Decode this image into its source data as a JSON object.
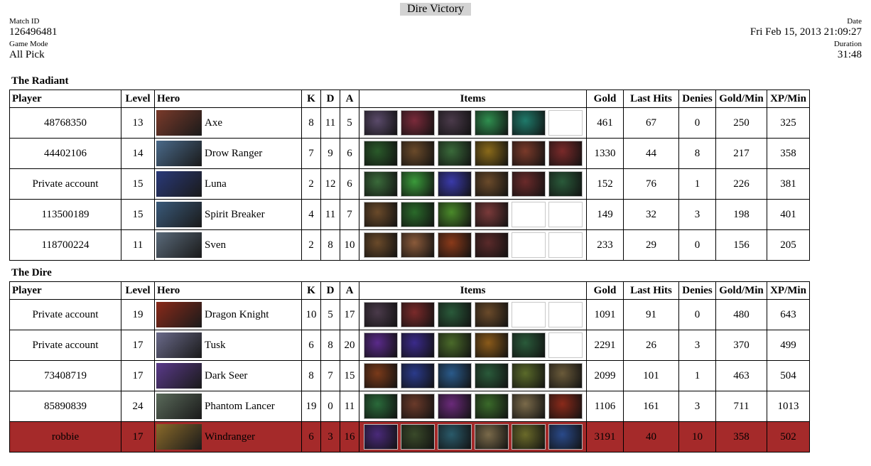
{
  "header": {
    "result": "Dire Victory",
    "match_id_label": "Match ID",
    "match_id": "126496481",
    "game_mode_label": "Game Mode",
    "game_mode": "All Pick",
    "date_label": "Date",
    "date": "Fri Feb 15, 2013 21:09:27",
    "duration_label": "Duration",
    "duration": "31:48"
  },
  "columns": {
    "player": "Player",
    "level": "Level",
    "hero": "Hero",
    "k": "K",
    "d": "D",
    "a": "A",
    "items": "Items",
    "gold": "Gold",
    "last_hits": "Last Hits",
    "denies": "Denies",
    "gpm": "Gold/Min",
    "xpm": "XP/Min"
  },
  "radiant": {
    "title": "The Radiant",
    "players": [
      {
        "player": "48768350",
        "level": "13",
        "hero": "Axe",
        "k": "8",
        "d": "11",
        "a": "5",
        "gold": "461",
        "last_hits": "67",
        "denies": "0",
        "gpm": "250",
        "xpm": "325",
        "hero_color": "#7a3a2a",
        "items": [
          "#5a4a6a",
          "#7a2a3a",
          "#4a3a4a",
          "#2f8f4f",
          "#1f7a6a",
          "",
          ""
        ]
      },
      {
        "player": "44402106",
        "level": "14",
        "hero": "Drow Ranger",
        "k": "7",
        "d": "9",
        "a": "6",
        "gold": "1330",
        "last_hits": "44",
        "denies": "8",
        "gpm": "217",
        "xpm": "358",
        "hero_color": "#4a6a8a",
        "items": [
          "#2a5a2a",
          "#6a4a2a",
          "#3a6a3a",
          "#8a6a1a",
          "#7a3a2a",
          "#7a2a2a",
          ""
        ]
      },
      {
        "player": "Private account",
        "level": "15",
        "hero": "Luna",
        "k": "2",
        "d": "12",
        "a": "6",
        "gold": "152",
        "last_hits": "76",
        "denies": "1",
        "gpm": "226",
        "xpm": "381",
        "hero_color": "#2a3a7a",
        "items": [
          "#3a6a3a",
          "#3a9a3a",
          "#3a3aaa",
          "#6a4a2a",
          "#6a2a2a",
          "#2a5a3a"
        ]
      },
      {
        "player": "113500189",
        "level": "15",
        "hero": "Spirit Breaker",
        "k": "4",
        "d": "11",
        "a": "7",
        "gold": "149",
        "last_hits": "32",
        "denies": "3",
        "gpm": "198",
        "xpm": "401",
        "hero_color": "#3a5a7a",
        "items": [
          "#6a4a2a",
          "#2a6a2a",
          "#4a8a2a",
          "#7a3a3a",
          "",
          ""
        ]
      },
      {
        "player": "118700224",
        "level": "11",
        "hero": "Sven",
        "k": "2",
        "d": "8",
        "a": "10",
        "gold": "233",
        "last_hits": "29",
        "denies": "0",
        "gpm": "156",
        "xpm": "205",
        "hero_color": "#5a6a7a",
        "items": [
          "#6a4a2a",
          "#8a5a3a",
          "#8a3a1a",
          "#5a2a2a",
          "",
          ""
        ]
      }
    ]
  },
  "dire": {
    "title": "The Dire",
    "players": [
      {
        "player": "Private account",
        "level": "19",
        "hero": "Dragon Knight",
        "k": "10",
        "d": "5",
        "a": "17",
        "gold": "1091",
        "last_hits": "91",
        "denies": "0",
        "gpm": "480",
        "xpm": "643",
        "hero_color": "#8a2a1a",
        "items": [
          "#4a3a4a",
          "#7a2a2a",
          "#2a5a3a",
          "#6a4a2a",
          "",
          ""
        ],
        "highlight": false
      },
      {
        "player": "Private account",
        "level": "17",
        "hero": "Tusk",
        "k": "6",
        "d": "8",
        "a": "20",
        "gold": "2291",
        "last_hits": "26",
        "denies": "3",
        "gpm": "370",
        "xpm": "499",
        "hero_color": "#6a6a8a",
        "items": [
          "#5a2a8a",
          "#3a2a8a",
          "#4a6a2a",
          "#8a5a1a",
          "#2a5a3a",
          ""
        ],
        "highlight": false
      },
      {
        "player": "73408719",
        "level": "17",
        "hero": "Dark Seer",
        "k": "8",
        "d": "7",
        "a": "15",
        "gold": "2099",
        "last_hits": "101",
        "denies": "1",
        "gpm": "463",
        "xpm": "504",
        "hero_color": "#5a3a8a",
        "items": [
          "#7a3a1a",
          "#2a3a8a",
          "#2a5a8a",
          "#2a5a3a",
          "#5a6a2a",
          "#6a5a3a"
        ],
        "highlight": false
      },
      {
        "player": "85890839",
        "level": "24",
        "hero": "Phantom Lancer",
        "k": "19",
        "d": "0",
        "a": "11",
        "gold": "1106",
        "last_hits": "161",
        "denies": "3",
        "gpm": "711",
        "xpm": "1013",
        "hero_color": "#5a6a5a",
        "items": [
          "#2a6a3a",
          "#6a3a2a",
          "#6a2a7a",
          "#3a6a2a",
          "#7a6a4a",
          "#8a2a1a"
        ],
        "highlight": false
      },
      {
        "player": "robbie",
        "level": "17",
        "hero": "Windranger",
        "k": "6",
        "d": "3",
        "a": "16",
        "gold": "3191",
        "last_hits": "40",
        "denies": "10",
        "gpm": "358",
        "xpm": "502",
        "hero_color": "#8a6a2a",
        "items": [
          "#4a2a7a",
          "#3a4a2a",
          "#2a5a6a",
          "#7a6a4a",
          "#6a6a2a",
          "#2a4a8a"
        ],
        "highlight": true
      }
    ]
  }
}
